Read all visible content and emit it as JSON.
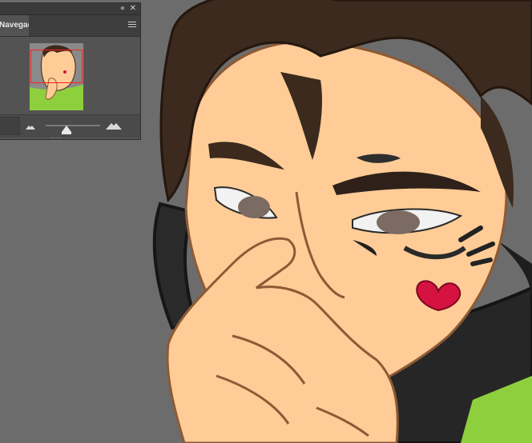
{
  "panel": {
    "tab_label": "Navegador",
    "collapse_glyph": "«",
    "close_glyph": "✕",
    "icons": [
      "collapse-panels-icon",
      "close-icon",
      "panel-menu-icon",
      "zoom-out-icon",
      "zoom-in-icon"
    ]
  },
  "zoom": {
    "slider_position": 0.38
  },
  "colors": {
    "canvas_bg": "#6c6c6c",
    "skin": "#ffcc97",
    "hair": "#3b2a1d",
    "line": "#8c5a35",
    "shirt": "#8ecf3e",
    "heart": "#d51240",
    "viewbox_outline": "#ff1f1f"
  }
}
